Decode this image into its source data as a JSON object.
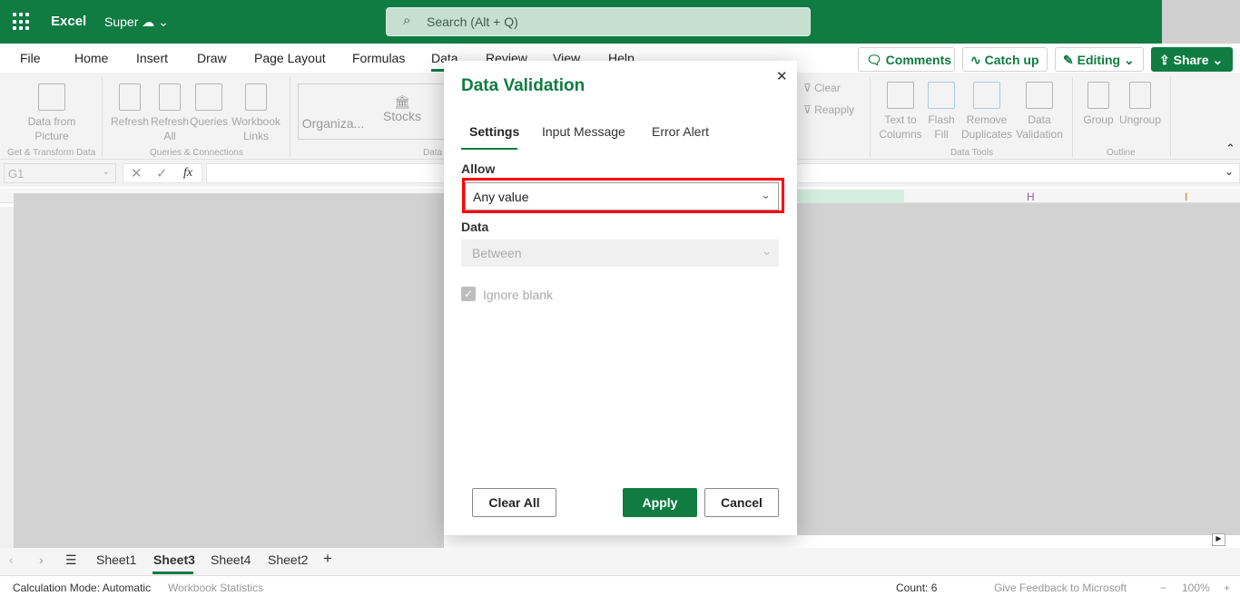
{
  "topbar": {
    "app_name": "Excel",
    "doc_name": "Super",
    "search_placeholder": "Search (Alt + Q)"
  },
  "menu_tabs": [
    "File",
    "Home",
    "Insert",
    "Draw",
    "Page Layout",
    "Formulas",
    "Data",
    "Review",
    "View",
    "Help"
  ],
  "active_tab": "Data",
  "actions": {
    "comments": "Comments",
    "catch_up": "Catch up",
    "editing": "Editing",
    "share": "Share"
  },
  "ribbon": {
    "data_from_picture": "Data from Picture",
    "refresh": "Refresh",
    "refresh_all": "Refresh All",
    "queries": "Queries",
    "workbook_links": "Workbook Links",
    "organization": "Organiza...",
    "stocks": "Stocks",
    "clear": "Clear",
    "reapply": "Reapply",
    "text_to_columns": "Text to Columns",
    "flash_fill": "Flash Fill",
    "remove_duplicates": "Remove Duplicates",
    "data_validation": "Data Validation",
    "group": "Group",
    "ungroup": "Ungroup",
    "groups": {
      "get_transform": "Get & Transform Data",
      "queries_connections": "Queries & Connections",
      "data_types": "Data",
      "data_tools": "Data Tools",
      "outline": "Outline"
    }
  },
  "formula_bar": {
    "name_box": "G1",
    "fx": "fx",
    "value": ""
  },
  "columns": {
    "h": "H",
    "i": "I"
  },
  "dialog": {
    "title": "Data Validation",
    "tabs": [
      "Settings",
      "Input Message",
      "Error Alert"
    ],
    "active_tab": "Settings",
    "allow_label": "Allow",
    "allow_value": "Any value",
    "data_label": "Data",
    "data_value": "Between",
    "ignore_blank": "Ignore blank",
    "ignore_blank_checked": true,
    "clear_all": "Clear All",
    "apply": "Apply",
    "cancel": "Cancel"
  },
  "sheets": {
    "tabs": [
      "Sheet1",
      "Sheet3",
      "Sheet4",
      "Sheet2"
    ],
    "active": "Sheet3"
  },
  "status": {
    "calc_mode": "Calculation Mode: Automatic",
    "workbook_stats": "Workbook Statistics",
    "count": "Count: 6",
    "feedback": "Give Feedback to Microsoft",
    "zoom": "100%"
  },
  "colors": {
    "brand": "#107c41",
    "highlight": "#ff0000"
  }
}
